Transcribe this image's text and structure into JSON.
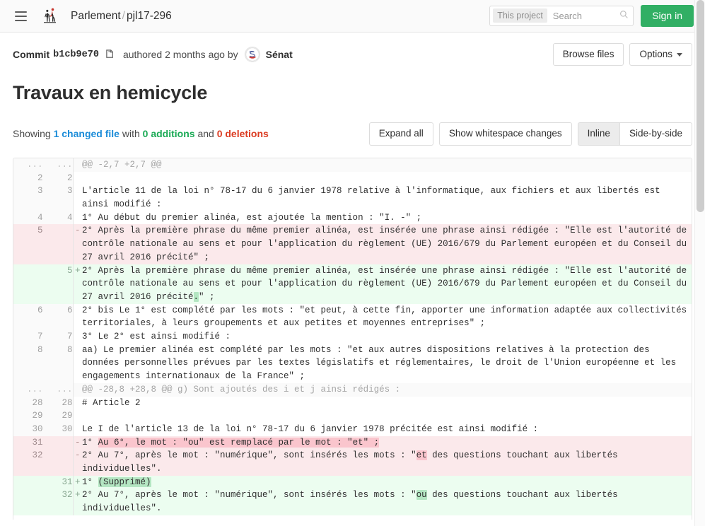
{
  "navbar": {
    "menu_icon": "hamburger-menu-icon",
    "logo_icon": "parlement-ouvert-logo",
    "group": "Parlement",
    "separator": "/",
    "project": "pjl17-296",
    "search": {
      "scope": "This project",
      "placeholder": "Search",
      "value": "",
      "icon": "search-icon"
    },
    "sign_in": "Sign in"
  },
  "commit_bar": {
    "commit_label": "Commit",
    "sha": "b1cb9e70",
    "copy_icon": "copy-icon",
    "authored": "authored 2 months ago by",
    "avatar_icon": "senat-avatar",
    "author": "Sénat",
    "browse_files": "Browse files",
    "options": "Options"
  },
  "title": "Travaux en hemicycle",
  "summary": {
    "showing": "Showing",
    "changed_file": "1 changed file",
    "with": "with",
    "additions": "0 additions",
    "and": "and",
    "deletions": "0 deletions"
  },
  "view_actions": {
    "expand_all": "Expand all",
    "show_whitespace": "Show whitespace changes",
    "inline": "Inline",
    "side_by_side": "Side-by-side",
    "active_view": "Inline"
  },
  "colors": {
    "brand_green": "#31af64",
    "link_blue": "#1b8cd8",
    "addition_green": "#1aaa55",
    "deletion_red": "#db3b21",
    "del_row_bg": "#fbe9eb",
    "add_row_bg": "#ecfdf0",
    "word_del_bg": "#fac5cd",
    "word_add_bg": "#b4e6c2"
  },
  "diff": {
    "rows": [
      {
        "type": "hunk",
        "old": "...",
        "new": "...",
        "sign": "",
        "parts": [
          {
            "t": "@@ -2,7 +2,7 @@",
            "h": ""
          }
        ]
      },
      {
        "type": "ctx",
        "old": "2",
        "new": "2",
        "sign": "",
        "parts": [
          {
            "t": "",
            "h": ""
          }
        ]
      },
      {
        "type": "ctx",
        "old": "3",
        "new": "3",
        "sign": "",
        "parts": [
          {
            "t": "L'article 11 de la loi n° 78-17 du 6 janvier 1978 relative à l'informatique, aux fichiers et aux libertés est ainsi modifié :",
            "h": ""
          }
        ]
      },
      {
        "type": "ctx",
        "old": "4",
        "new": "4",
        "sign": "",
        "parts": [
          {
            "t": "1° Au début du premier alinéa, est ajoutée la mention : \"I. -\" ;",
            "h": ""
          }
        ]
      },
      {
        "type": "del",
        "old": "5",
        "new": "",
        "sign": "-",
        "parts": [
          {
            "t": "2° Après la première phrase du même premier alinéa, est insérée une phrase ainsi rédigée : \"Elle est l'autorité de contrôle nationale au sens et pour l'application du règlement (UE) 2016/679 du Parlement européen et du Conseil du 27 avril 2016 précité\" ;",
            "h": ""
          }
        ]
      },
      {
        "type": "add",
        "old": "",
        "new": "5",
        "sign": "+",
        "parts": [
          {
            "t": "2° Après la première phrase du même premier alinéa, est insérée une phrase ainsi rédigée : \"Elle est l'autorité de contrôle nationale au sens et pour l'application du règlement (UE) 2016/679 du Parlement européen et du Conseil du 27 avril 2016 précité",
            "h": ""
          },
          {
            "t": ".",
            "h": "add"
          },
          {
            "t": "\" ;",
            "h": ""
          }
        ]
      },
      {
        "type": "ctx",
        "old": "6",
        "new": "6",
        "sign": "",
        "parts": [
          {
            "t": "2° bis Le 1° est complété par les mots : \"et peut, à cette fin, apporter une information adaptée aux collectivités territoriales, à leurs groupements et aux petites et moyennes entreprises\" ;",
            "h": ""
          }
        ]
      },
      {
        "type": "ctx",
        "old": "7",
        "new": "7",
        "sign": "",
        "parts": [
          {
            "t": "3° Le 2° est ainsi modifié :",
            "h": ""
          }
        ]
      },
      {
        "type": "ctx",
        "old": "8",
        "new": "8",
        "sign": "",
        "parts": [
          {
            "t": "aa) Le premier alinéa est complété par les mots : \"et aux autres dispositions relatives à la protection des données personnelles prévues par les textes législatifs et réglementaires, le droit de l'Union européenne et les engagements internationaux de la France\" ;",
            "h": ""
          }
        ]
      },
      {
        "type": "hunk",
        "old": "...",
        "new": "...",
        "sign": "",
        "parts": [
          {
            "t": "@@ -28,8 +28,8 @@ g) Sont ajoutés des i et j ainsi rédigés :",
            "h": ""
          }
        ]
      },
      {
        "type": "ctx",
        "old": "28",
        "new": "28",
        "sign": "",
        "parts": [
          {
            "t": "# Article 2",
            "h": ""
          }
        ]
      },
      {
        "type": "ctx",
        "old": "29",
        "new": "29",
        "sign": "",
        "parts": [
          {
            "t": "",
            "h": ""
          }
        ]
      },
      {
        "type": "ctx",
        "old": "30",
        "new": "30",
        "sign": "",
        "parts": [
          {
            "t": "Le I de l'article 13 de la loi n° 78-17 du 6 janvier 1978 précitée est ainsi modifié :",
            "h": ""
          }
        ]
      },
      {
        "type": "del",
        "old": "31",
        "new": "",
        "sign": "-",
        "parts": [
          {
            "t": "1° ",
            "h": ""
          },
          {
            "t": "Au 6°, le mot : \"ou\" est remplacé par le mot : \"et\" ;",
            "h": "del"
          }
        ]
      },
      {
        "type": "del",
        "old": "32",
        "new": "",
        "sign": "-",
        "parts": [
          {
            "t": "2° Au 7°, après le mot : \"numérique\", sont insérés les mots : \"",
            "h": ""
          },
          {
            "t": "et",
            "h": "del"
          },
          {
            "t": " des questions touchant aux libertés individuelles\".",
            "h": ""
          }
        ]
      },
      {
        "type": "add",
        "old": "",
        "new": "31",
        "sign": "+",
        "parts": [
          {
            "t": "1° ",
            "h": ""
          },
          {
            "t": "(Supprimé)",
            "h": "add"
          }
        ]
      },
      {
        "type": "add",
        "old": "",
        "new": "32",
        "sign": "+",
        "parts": [
          {
            "t": "2° Au 7°, après le mot : \"numérique\", sont insérés les mots : \"",
            "h": ""
          },
          {
            "t": "ou",
            "h": "add"
          },
          {
            "t": " des questions touchant aux libertés individuelles\".",
            "h": ""
          }
        ]
      }
    ]
  }
}
